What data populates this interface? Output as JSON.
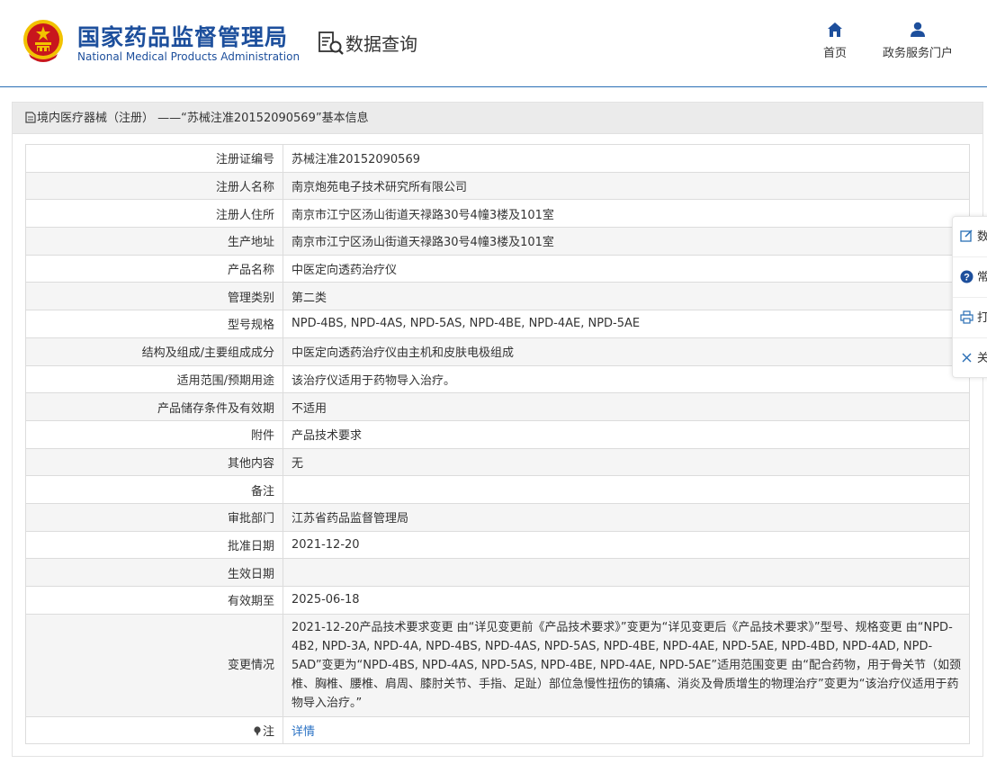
{
  "header": {
    "org_cn": "国家药品监督管理局",
    "org_en": "National Medical Products Administration",
    "section_title": "数据查询",
    "nav": [
      {
        "label": "首页",
        "icon": "home-icon"
      },
      {
        "label": "政务服务门户",
        "icon": "user-icon"
      }
    ]
  },
  "panel": {
    "title": "境内医疗器械（注册） ——“苏械注准20152090569”基本信息"
  },
  "rows": [
    {
      "label": "注册证编号",
      "value": "苏械注准20152090569"
    },
    {
      "label": "注册人名称",
      "value": "南京炮苑电子技术研究所有限公司"
    },
    {
      "label": "注册人住所",
      "value": "南京市江宁区汤山街道天禄路30号4幢3楼及101室"
    },
    {
      "label": "生产地址",
      "value": "南京市江宁区汤山街道天禄路30号4幢3楼及101室"
    },
    {
      "label": "产品名称",
      "value": "中医定向透药治疗仪"
    },
    {
      "label": "管理类别",
      "value": "第二类"
    },
    {
      "label": "型号规格",
      "value": "NPD-4BS, NPD-4AS, NPD-5AS, NPD-4BE, NPD-4AE, NPD-5AE"
    },
    {
      "label": "结构及组成/主要组成成分",
      "value": "中医定向透药治疗仪由主机和皮肤电极组成"
    },
    {
      "label": "适用范围/预期用途",
      "value": "该治疗仪适用于药物导入治疗。"
    },
    {
      "label": "产品储存条件及有效期",
      "value": "不适用"
    },
    {
      "label": "附件",
      "value": "产品技术要求"
    },
    {
      "label": "其他内容",
      "value": "无"
    },
    {
      "label": "备注",
      "value": ""
    },
    {
      "label": "审批部门",
      "value": "江苏省药品监督管理局"
    },
    {
      "label": "批准日期",
      "value": "2021-12-20"
    },
    {
      "label": "生效日期",
      "value": ""
    },
    {
      "label": "有效期至",
      "value": "2025-06-18"
    },
    {
      "label": "变更情况",
      "value": "2021-12-20产品技术要求变更 由“详见变更前《产品技术要求》”变更为“详见变更后《产品技术要求》”型号、规格变更 由“NPD-4B2, NPD-3A, NPD-4A, NPD-4BS, NPD-4AS, NPD-5AS, NPD-4BE, NPD-4AE, NPD-5AE, NPD-4BD, NPD-4AD, NPD-5AD”变更为“NPD-4BS, NPD-4AS, NPD-5AS, NPD-4BE, NPD-4AE, NPD-5AE”适用范围变更 由“配合药物，用于骨关节（如颈椎、胸椎、腰椎、肩周、膝肘关节、手指、足趾）部位急慢性扭伤的镇痛、消炎及骨质增生的物理治疗”变更为“该治疗仪适用于药物导入治疗。”"
    }
  ],
  "note": {
    "label": "注",
    "link": "详情"
  },
  "float_bar": [
    {
      "label": "数",
      "icon": "edit-icon"
    },
    {
      "label": "常",
      "icon": "question-icon"
    },
    {
      "label": "打",
      "icon": "print-icon"
    },
    {
      "label": "关",
      "icon": "close-icon"
    }
  ],
  "colors": {
    "brand": "#1d4f9c",
    "link": "#2a72c4",
    "emblem_red": "#c8161d",
    "emblem_gold": "#f2c200"
  }
}
